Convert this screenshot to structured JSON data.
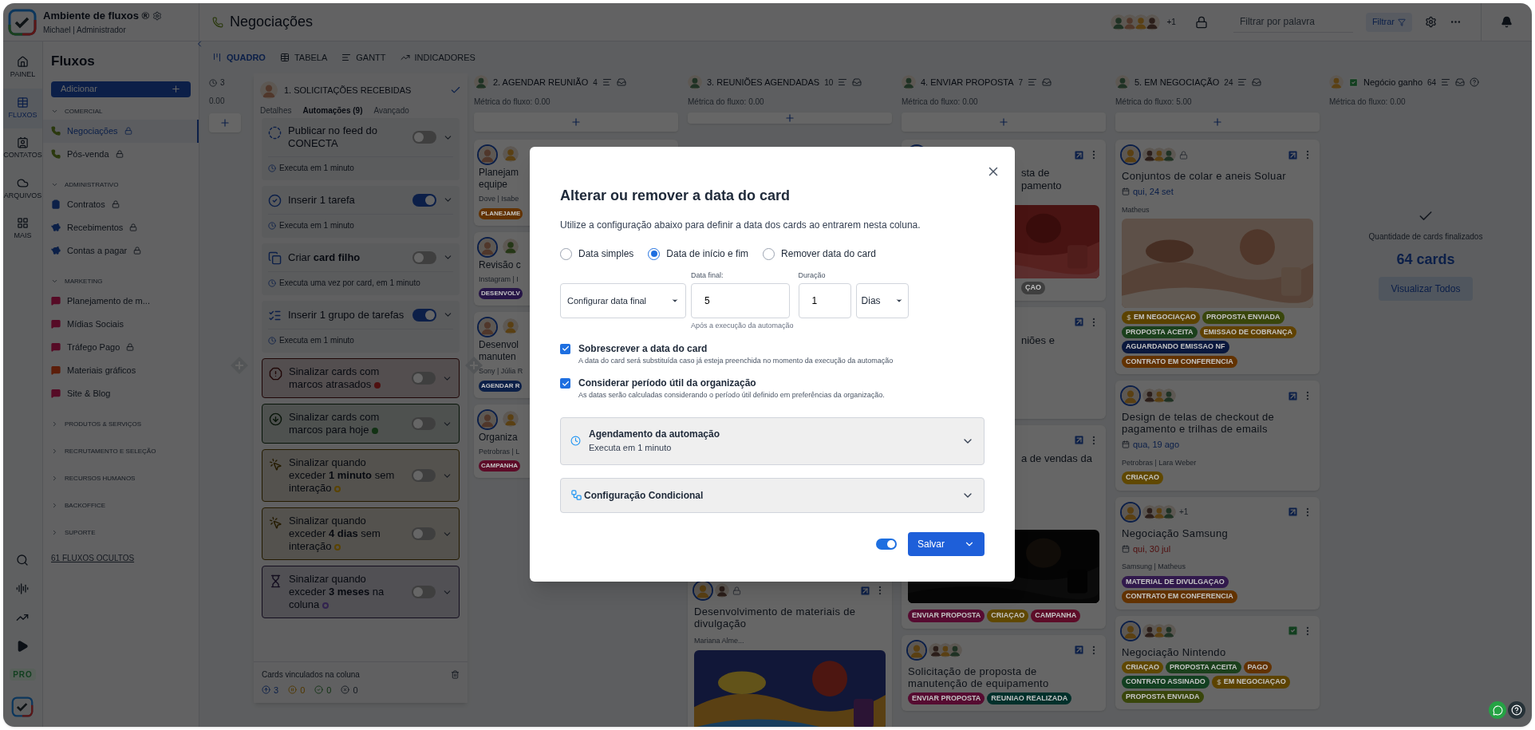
{
  "app": {
    "workspace": "Ambiente de fluxos ®",
    "user": "Michael | Administrador"
  },
  "rail": {
    "items": [
      {
        "label": "PAINEL",
        "selected": false
      },
      {
        "label": "FLUXOS",
        "selected": true
      },
      {
        "label": "CONTATOS",
        "selected": false
      },
      {
        "label": "ARQUIVOS",
        "selected": false
      },
      {
        "label": "MAIS",
        "selected": false
      }
    ],
    "badge": "PRO"
  },
  "sidebar": {
    "title": "Fluxos",
    "add_button": "Adicionar",
    "groups": [
      {
        "label": "COMERCIAL",
        "expanded": true,
        "items": [
          {
            "label": "Negociações",
            "selected": true,
            "locked": true,
            "color": "#2b390e"
          },
          {
            "label": "Pós-venda",
            "selected": false,
            "locked": true,
            "color": "#2b390e"
          }
        ]
      },
      {
        "label": "ADMINISTRATIVO",
        "expanded": true,
        "items": [
          {
            "label": "Contratos",
            "selected": false,
            "locked": true,
            "color": "#0c2048"
          },
          {
            "label": "Recebimentos",
            "selected": false,
            "locked": true,
            "color": "#0c2048"
          },
          {
            "label": "Contas a pagar",
            "selected": false,
            "locked": true,
            "color": "#0c2048"
          }
        ]
      },
      {
        "label": "MARKETING",
        "expanded": true,
        "items": [
          {
            "label": "Planejamento de m...",
            "selected": false,
            "locked": false,
            "color": "#560b26"
          },
          {
            "label": "Mídias Sociais",
            "selected": false,
            "locked": false,
            "color": "#560b26"
          },
          {
            "label": "Tráfego Pago",
            "selected": false,
            "locked": true,
            "color": "#560b26"
          },
          {
            "label": "Materiais gráficos",
            "selected": false,
            "locked": false,
            "color": "#5c1e0a"
          },
          {
            "label": "Site & Blog",
            "selected": false,
            "locked": false,
            "color": "#560b26"
          }
        ]
      },
      {
        "label": "PRODUTOS & SERVIÇOS",
        "expanded": false
      },
      {
        "label": "RECRUTAMENTO E SELEÇÃO",
        "expanded": false
      },
      {
        "label": "RECURSOS HUMANOS",
        "expanded": false
      },
      {
        "label": "BACKOFFICE",
        "expanded": false
      },
      {
        "label": "SUPORTE",
        "expanded": false
      }
    ],
    "hidden_link": "61 FLUXOS OCULTOS"
  },
  "page": {
    "title": "Negociações",
    "members_more": "+1",
    "search": {
      "placeholder": "Filtrar por palavra"
    },
    "filter_button": "Filtrar"
  },
  "view_tabs": [
    {
      "label": "QUADRO",
      "selected": true
    },
    {
      "label": "TABELA",
      "selected": false
    },
    {
      "label": "GANTT",
      "selected": false
    },
    {
      "label": "INDICADORES",
      "selected": false
    }
  ],
  "board": {
    "first_column": {
      "count": "3",
      "metric": "0.00"
    },
    "automation_panel": {
      "title": "1. SOLICITAÇÕES RECEBIDAS",
      "tabs": [
        {
          "label": "Detalhes",
          "selected": false
        },
        {
          "label": "Automações (9)",
          "selected": true
        },
        {
          "label": "Avançado",
          "selected": false
        }
      ],
      "automations": [
        {
          "kind": "task",
          "title": "Publicar no feed do CONECTA",
          "on": false,
          "schedule": "Executa em 1 minuto"
        },
        {
          "kind": "task",
          "title": "Inserir 1 tarefa",
          "on": true,
          "schedule": "Executa em 1 minuto"
        },
        {
          "kind": "task",
          "title": "Criar **card filho**",
          "on": false,
          "schedule": "Executa uma vez por card, em 1 minuto"
        },
        {
          "kind": "task",
          "title": "Inserir 1 grupo de tarefas",
          "on": true,
          "schedule": "Executa em 1 minuto"
        },
        {
          "kind": "signal",
          "title": "Sinalizar cards com marcos atrasados",
          "on": false,
          "color": "#4f1010",
          "hollow": false
        },
        {
          "kind": "signal",
          "title": "Sinalizar cards com marcos para hoje",
          "on": false,
          "color": "#123214",
          "hollow": false
        },
        {
          "kind": "signal",
          "title": "Sinalizar quando exceder **1 minuto** sem interação",
          "on": false,
          "color": "#5a4300",
          "hollow": true
        },
        {
          "kind": "signal",
          "title": "Sinalizar quando exceder **4 dias** sem interação",
          "on": false,
          "color": "#5a4300",
          "hollow": true
        },
        {
          "kind": "signal",
          "title": "Sinalizar quando exceder **3 meses** na coluna",
          "on": false,
          "color": "#32234e",
          "hollow": true
        }
      ],
      "footer": {
        "label": "Cards vinculados na coluna",
        "counts": [
          {
            "kind": "moved",
            "value": "3"
          },
          {
            "kind": "paused",
            "value": "0"
          },
          {
            "kind": "done",
            "value": "0"
          },
          {
            "kind": "removed",
            "value": "0"
          }
        ]
      }
    },
    "columns": [
      {
        "title": "2. AGENDAR REUNIÃO",
        "count": "4",
        "metric": "Métrica do fluxo: 0.00",
        "cards": [
          {
            "kind": "clipped_right",
            "lines": [
              "Planejam",
              "equipe"
            ],
            "meta": "Dove | Isabe",
            "tags": [
              {
                "label": "PLANEJAME",
                "color": "#623200"
              }
            ]
          },
          {
            "kind": "clipped_right",
            "lines": [
              "Revisão c"
            ],
            "meta": "Instagram | I",
            "tags": [
              {
                "label": "DESENVOLV",
                "color": "#261547"
              }
            ]
          },
          {
            "kind": "clipped_right",
            "lines": [
              "Desenvol",
              "manuten"
            ],
            "meta": "Sony | Júlia R",
            "tags": [
              {
                "label": "AGENDAR R",
                "color": "#0c2048"
              }
            ]
          },
          {
            "kind": "clipped_right",
            "lines": [
              "Organiza"
            ],
            "meta": "Petrobras | L",
            "tags": [
              {
                "label": "CAMPANHA",
                "color": "#5d0c28"
              }
            ]
          }
        ]
      },
      {
        "title": "3. REUNIÕES AGENDADAS",
        "count": "10",
        "metric": "Métrica do fluxo: 0.00",
        "cards": [
          {
            "kind": "full",
            "title": "Desenvolvimento de materiais de divulgação",
            "meta": "Mariana Alme...",
            "locked": true,
            "picture": true
          }
        ]
      },
      {
        "title": "4. ENVIAR PROPOSTA",
        "count": "7",
        "metric": "Métrica do fluxo: 0.00",
        "cards": [
          {
            "kind": "clipped_left",
            "lines": [
              "sta de",
              "pamento"
            ],
            "picture": true,
            "tag_fragments": [
              {
                "label": "ÇAO",
                "color": "#3f3f3f"
              }
            ]
          },
          {
            "kind": "clipped_left",
            "lines": [
              "niões e"
            ]
          },
          {
            "kind": "clipped_left",
            "lines": [
              "a de vendas da"
            ],
            "picture": true,
            "tags": [
              {
                "label": "ENVIAR PROPOSTA",
                "color": "#560b31"
              },
              {
                "label": "CRIAÇAO",
                "color": "#604800"
              },
              {
                "label": "CAMPANHA",
                "color": "#5d0c28"
              }
            ]
          },
          {
            "kind": "full",
            "title": "Solicitação de proposta de manutenção de equipamento",
            "tags": [
              {
                "label": "ENVIAR PROPOSTA",
                "color": "#560b31"
              },
              {
                "label": "REUNIAO REALIZADA",
                "color": "#00302b"
              }
            ]
          }
        ]
      },
      {
        "title": "5. EM NEGOCIAÇÃO",
        "count": "24",
        "metric": "Métrica do fluxo: 5.00",
        "cards": [
          {
            "kind": "full",
            "title": "Conjuntos de colar e aneis Soluar",
            "locked": true,
            "date": "qui, 24 set",
            "overdue": false,
            "meta": "Matheus",
            "picture": true,
            "tags": [
              {
                "label": "EM NEGOCIAÇAO",
                "color": "#5c4300",
                "money": true
              },
              {
                "label": "PROPOSTA ENVIADA",
                "color": "#39460b"
              },
              {
                "label": "PROPOSTA ACEITA",
                "color": "#1b401c"
              },
              {
                "label": "EMISSAO DE COBRANÇA",
                "color": "#604200"
              },
              {
                "label": "AGUARDANDO EMISSAO NF",
                "color": "#0a183d"
              },
              {
                "label": "CONTRATO EM CONFERENCIA",
                "color": "#623200"
              }
            ]
          },
          {
            "kind": "full",
            "title": "Design de telas de checkout de pagamento e trilhas de emails",
            "date": "qua, 19 ago",
            "overdue": false,
            "meta": "Petrobras | Lara Weber",
            "tags": [
              {
                "label": "CRIAÇAO",
                "color": "#604800"
              }
            ]
          },
          {
            "kind": "full",
            "title": "Negociação Samsung",
            "members_more": "+1",
            "date": "qui, 30 jul",
            "overdue": true,
            "meta": "Samsung | Matheus",
            "tags": [
              {
                "label": "MATERIAL DE DIVULGAÇAO",
                "color": "#31194c"
              },
              {
                "label": "CONTRATO EM CONFERENCIA",
                "color": "#623200"
              }
            ]
          },
          {
            "kind": "full",
            "title": "Negociação Nintendo",
            "done": true,
            "tags": [
              {
                "label": "CRIAÇAO",
                "color": "#604800"
              },
              {
                "label": "PROPOSTA ACEITA",
                "color": "#1b401c"
              },
              {
                "label": "PAGO",
                "color": "#623200"
              },
              {
                "label": "CONTRATO ASSINADO",
                "color": "#123f20"
              },
              {
                "label": "EM NEGOCIAÇAO",
                "color": "#5c4300",
                "money": true
              },
              {
                "label": "PROPOSTA ENVIADA",
                "color": "#39460b"
              }
            ]
          }
        ]
      }
    ],
    "won_column": {
      "title": "Negócio ganho",
      "count": "64",
      "metric": "Métrica do fluxo: 0.00",
      "summary_label": "Quantidade de cards finalizados",
      "summary_value": "64 cards",
      "view_all": "Visualizar Todos"
    }
  },
  "modal": {
    "title": "Alterar ou remover a data do card",
    "description": "Utilize a configuração abaixo para definir a data dos cards ao entrarem nesta coluna.",
    "date_modes": [
      {
        "label": "Data simples",
        "selected": false
      },
      {
        "label": "Data de início e fim",
        "selected": true
      },
      {
        "label": "Remover data do card",
        "selected": false
      }
    ],
    "end_date_select": "Configurar data final",
    "end_date": {
      "label": "Data final:",
      "value": "5",
      "hint": "Após a execução da automação"
    },
    "duration": {
      "label": "Duração",
      "value": "1",
      "unit": "Dias"
    },
    "options": [
      {
        "title": "Sobrescrever a data do card",
        "description": "A data do card será substituída caso já esteja preenchida no momento da execução da automação",
        "checked": true
      },
      {
        "title": "Considerar período útil da organização",
        "description": "As datas serão calculadas considerando o período útil definido em preferências da organização.",
        "checked": true
      }
    ],
    "sections": [
      {
        "kind": "schedule",
        "title": "Agendamento da automação",
        "subtitle": "Executa em 1 minuto"
      },
      {
        "kind": "conditional",
        "title": "Configuração Condicional"
      }
    ],
    "active": true,
    "save_button": "Salvar"
  }
}
